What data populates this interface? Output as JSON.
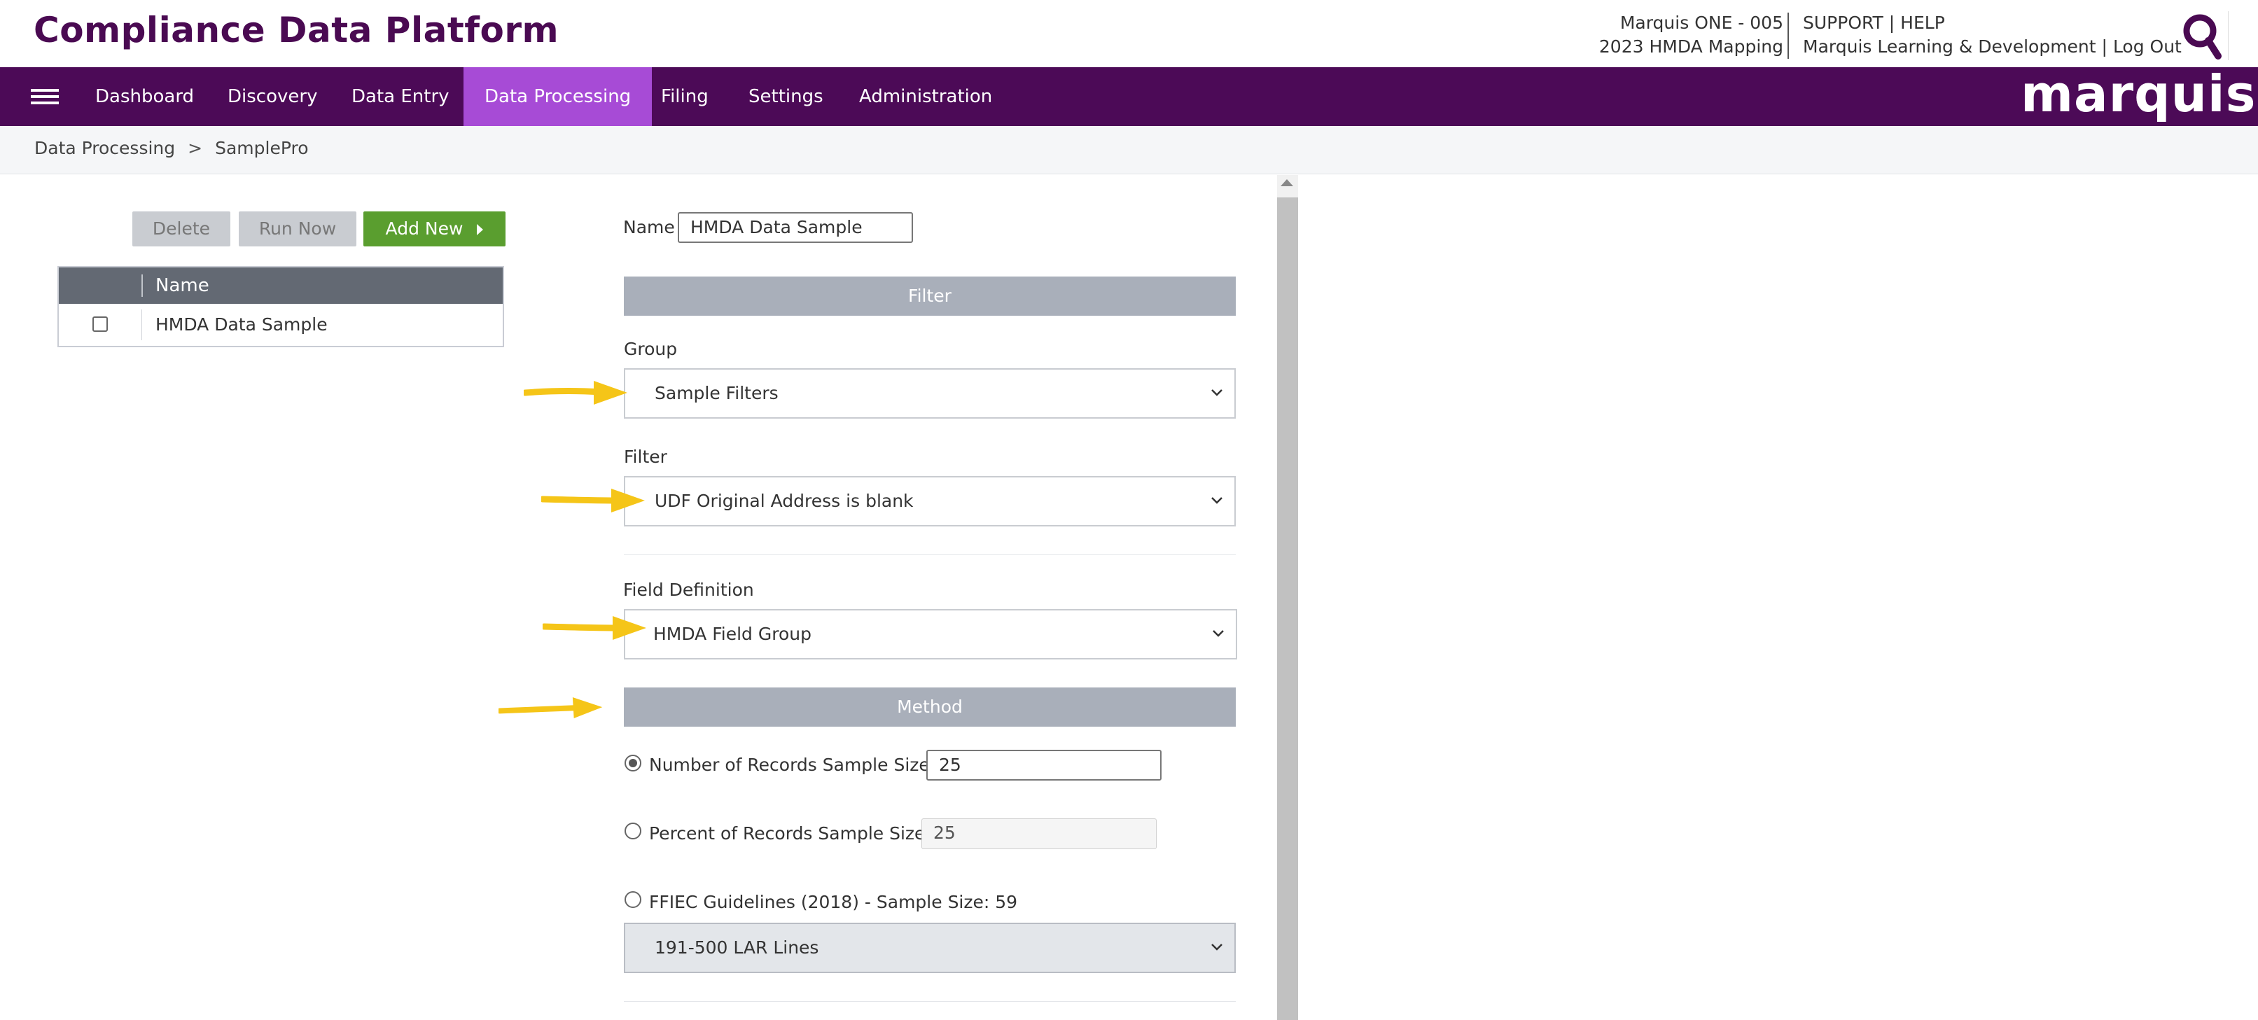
{
  "header": {
    "app_title": "Compliance Data Platform",
    "info_line1": "Marquis ONE - 005",
    "info_line2": "2023 HMDA Mapping",
    "support": "SUPPORT",
    "help": "HELP",
    "org": "Marquis Learning & Development",
    "logout": "Log Out",
    "link_sep": "|"
  },
  "nav": {
    "items": [
      "Dashboard",
      "Discovery",
      "Data Entry",
      "Data Processing",
      "Filing",
      "Settings",
      "Administration"
    ],
    "active": "Data Processing",
    "brand": "marquis",
    "active_color": "#a74bd6",
    "bar_color": "#4c0a57"
  },
  "breadcrumb": {
    "items": [
      "Data Processing",
      "SamplePro"
    ],
    "separator": ">"
  },
  "toolbar": {
    "delete_label": "Delete",
    "run_now_label": "Run Now",
    "add_new_label": "Add New"
  },
  "list": {
    "header_name": "Name",
    "rows": [
      {
        "name": "HMDA Data Sample",
        "checked": false
      }
    ]
  },
  "form": {
    "name_label": "Name",
    "name_value": "HMDA Data Sample",
    "filter_section": "Filter",
    "group_label": "Group",
    "group_value": "Sample Filters",
    "filter_label": "Filter",
    "filter_value": "UDF Original Address is blank",
    "field_definition_label": "Field Definition",
    "field_definition_value": "HMDA Field Group",
    "method_section": "Method",
    "options": {
      "number_label": "Number of Records Sample Size",
      "number_value": "25",
      "number_selected": true,
      "percent_label": "Percent of Records Sample Size",
      "percent_value": "25",
      "ffiec_label": "FFIEC Guidelines (2018) - Sample Size: 59",
      "ffiec_select_value": "191-500 LAR Lines"
    }
  },
  "colors": {
    "brand_purple": "#4c0a57",
    "title_purple": "#4a0a52",
    "add_button": "#5a9e2f",
    "section_bar": "#a9afba",
    "annotation_arrow": "#f5c518"
  }
}
